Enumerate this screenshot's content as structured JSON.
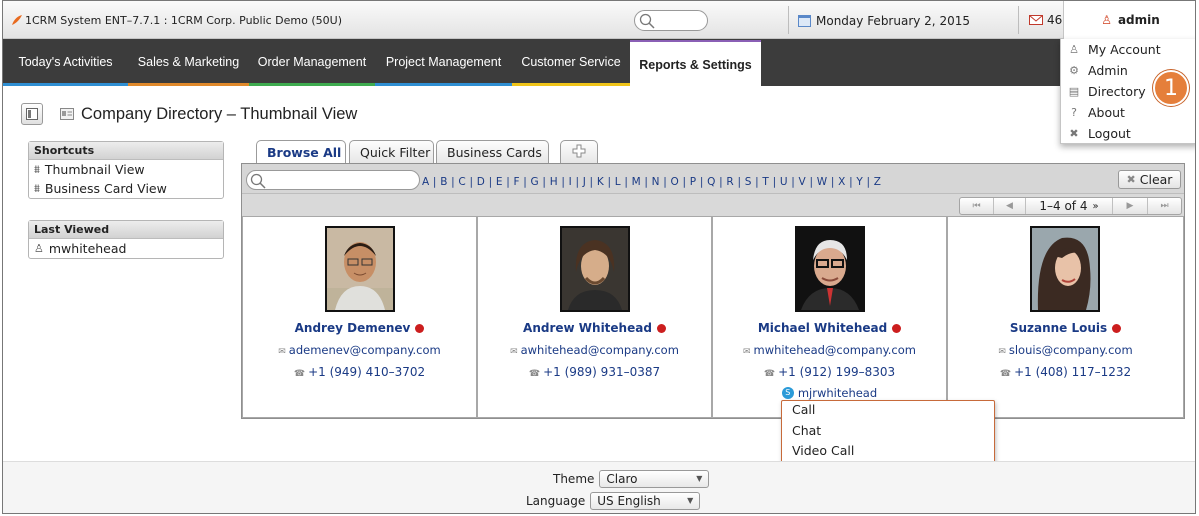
{
  "window": {
    "title": "1CRM System ENT–7.7.1 : 1CRM Corp. Public Demo (50U)"
  },
  "topbar": {
    "date": "Monday February 2, 2015",
    "mail_count": "46",
    "user": "admin"
  },
  "nav": {
    "items": [
      {
        "label": "Today's Activities",
        "color": "#2f8fd3"
      },
      {
        "label": "Sales & Marketing",
        "color": "#e0892b"
      },
      {
        "label": "Order Management",
        "color": "#3eab4f"
      },
      {
        "label": "Project Management",
        "color": "#2f8fd3"
      },
      {
        "label": "Customer Service",
        "color": "#f0c419"
      },
      {
        "label": "Reports & Settings",
        "color": "#8a5fb5"
      }
    ]
  },
  "user_menu": {
    "items": [
      {
        "label": "My Account",
        "icon": "person-icon"
      },
      {
        "label": "Admin",
        "icon": "gear-icon"
      },
      {
        "label": "Directory",
        "icon": "directory-icon"
      },
      {
        "label": "About",
        "icon": "question-icon"
      },
      {
        "label": "Logout",
        "icon": "logout-icon"
      }
    ],
    "callout": "1"
  },
  "page": {
    "title": "Company Directory – Thumbnail View"
  },
  "sidebar": {
    "shortcuts_title": "Shortcuts",
    "shortcuts": [
      "Thumbnail View",
      "Business Card View"
    ],
    "last_viewed_title": "Last Viewed",
    "last_viewed": [
      "mwhitehead"
    ]
  },
  "tabs": [
    "Browse All",
    "Quick Filter",
    "Business Cards"
  ],
  "filter": {
    "alphabet": "A | B | C | D | E | F | G | H | I | J | K | L | M | N | O | P | Q | R | S | T | U | V | W | X | Y | Z",
    "clear_label": "Clear"
  },
  "pager": {
    "range": "1–4 of 4"
  },
  "contacts": [
    {
      "name": "Andrey Demenev",
      "email": "ademenev@company.com",
      "phone": "+1 (949) 410–3702",
      "skype": ""
    },
    {
      "name": "Andrew Whitehead",
      "email": "awhitehead@company.com",
      "phone": "+1 (989) 931–0387",
      "skype": ""
    },
    {
      "name": "Michael Whitehead",
      "email": "mwhitehead@company.com",
      "phone": "+1 (912) 199–8303",
      "skype": "mjrwhitehead"
    },
    {
      "name": "Suzanne Louis",
      "email": "slouis@company.com",
      "phone": "+1 (408) 117–1232",
      "skype": ""
    }
  ],
  "context_menu": [
    "Call",
    "Chat",
    "Video Call"
  ],
  "footer": {
    "theme_label": "Theme",
    "theme_value": "Claro",
    "language_label": "Language",
    "language_value": "US English"
  }
}
